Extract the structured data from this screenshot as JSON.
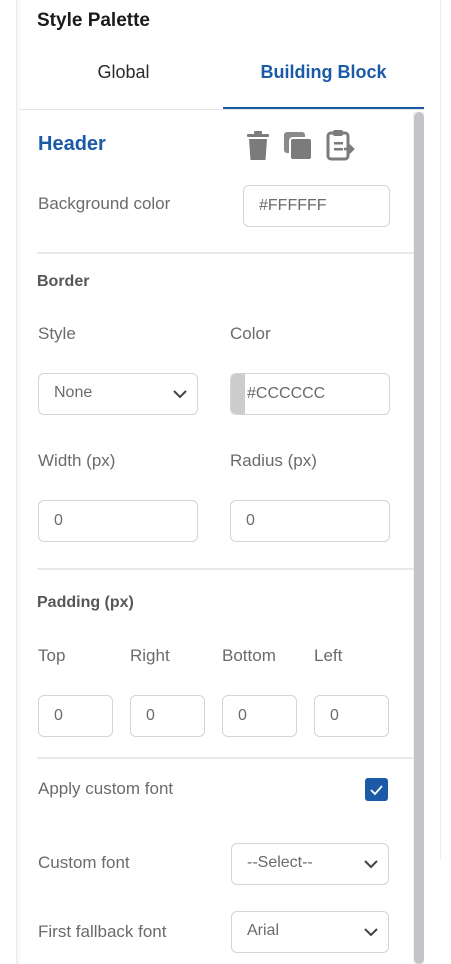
{
  "panel": {
    "title": "Style Palette",
    "tabs": [
      {
        "label": "Global",
        "active": false
      },
      {
        "label": "Building Block",
        "active": true
      }
    ]
  },
  "section": {
    "title": "Header",
    "actions": [
      "trash-icon",
      "copy-icon",
      "paste-icon"
    ]
  },
  "background": {
    "label": "Background color",
    "value": "#FFFFFF"
  },
  "border": {
    "heading": "Border",
    "style_label": "Style",
    "style_value": "None",
    "color_label": "Color",
    "color_value": "#CCCCCC",
    "width_label": "Width (px)",
    "width_value": "0",
    "radius_label": "Radius (px)",
    "radius_value": "0"
  },
  "padding": {
    "heading": "Padding (px)",
    "fields": [
      {
        "label": "Top",
        "value": "0"
      },
      {
        "label": "Right",
        "value": "0"
      },
      {
        "label": "Bottom",
        "value": "0"
      },
      {
        "label": "Left",
        "value": "0"
      }
    ]
  },
  "font": {
    "apply_label": "Apply custom font",
    "apply_checked": true,
    "custom_label": "Custom font",
    "custom_value": "--Select--",
    "fallback_label": "First fallback font",
    "fallback_value": "Arial"
  },
  "colors": {
    "accent": "#1a5aa6",
    "swatch": "#CCCCCC"
  }
}
